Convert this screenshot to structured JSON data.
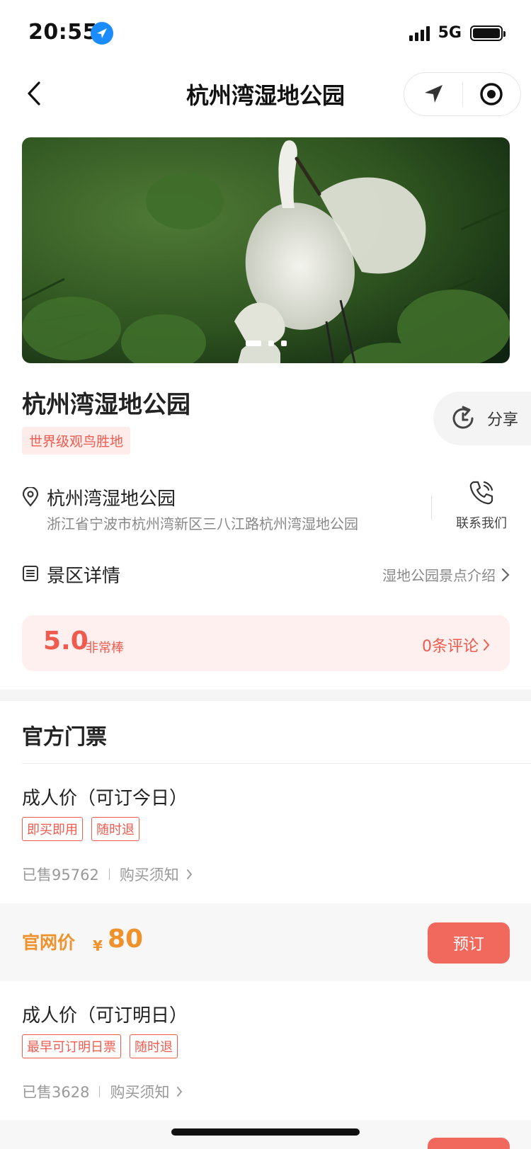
{
  "status_bar": {
    "time": "20:55",
    "network": "5G",
    "location_icon": "location-arrow-icon",
    "battery_level": 0.9
  },
  "nav": {
    "title": "杭州湾湿地公园",
    "back_icon": "chevron-left-icon",
    "capsule_icons": [
      "navigate-arrow-icon",
      "record-target-icon"
    ]
  },
  "banner": {
    "image": "egret-photo",
    "slide_count": 3,
    "active_slide": 1
  },
  "poi": {
    "title": "杭州湾湿地公园",
    "tag": "世界级观鸟胜地",
    "share_label": "分享",
    "address_name": "杭州湾湿地公园",
    "address_detail": "浙江省宁波市杭州湾新区三八江路杭州湾湿地公园",
    "contact_label": "联系我们",
    "detail_title": "景区详情",
    "detail_link": "湿地公园景点介绍"
  },
  "rating": {
    "score": "5.0",
    "word": "非常棒",
    "reviews": "0条评论"
  },
  "tickets": {
    "section_title": "官方门票",
    "items": [
      {
        "name": "成人价（可订今日）",
        "tags": [
          "即买即用",
          "随时退"
        ],
        "sold": "已售95762",
        "notice": "购买须知",
        "price_label": "官网价",
        "currency": "¥",
        "price": "80",
        "book_label": "预订"
      },
      {
        "name": "成人价（可订明日）",
        "tags": [
          "最早可订明日票",
          "随时退"
        ],
        "sold": "已售3628",
        "notice": "购买须知"
      }
    ]
  },
  "colors": {
    "accent": "#ef5b4f",
    "price": "#f0922c",
    "book_button": "#f1685c"
  }
}
